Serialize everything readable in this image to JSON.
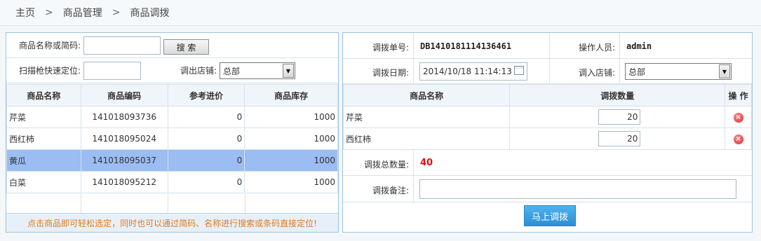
{
  "breadcrumb": {
    "home": "主页",
    "sep1": ">",
    "level1": "商品管理",
    "sep2": ">",
    "level2": "商品调拨"
  },
  "search": {
    "name_label": "商品名称或简码:",
    "name_value": "",
    "search_button": "搜 索",
    "scan_label": "扫描枪快速定位:",
    "scan_value": "",
    "out_store_label": "调出店铺:",
    "out_store_value": "总部"
  },
  "products": {
    "headers": [
      "商品名称",
      "商品编码",
      "参考进价",
      "商品库存"
    ],
    "rows": [
      {
        "name": "芹菜",
        "code": "141018093736",
        "price": "0",
        "stock": "1000"
      },
      {
        "name": "西红柿",
        "code": "141018095024",
        "price": "0",
        "stock": "1000"
      },
      {
        "name": "黄瓜",
        "code": "141018095037",
        "price": "0",
        "stock": "1000"
      },
      {
        "name": "白菜",
        "code": "141018095212",
        "price": "0",
        "stock": "1000"
      }
    ],
    "selected_index": 2,
    "tip": "点击商品即可轻松选定，同时也可以通过简码、名称进行搜索或条码直接定位!"
  },
  "transfer": {
    "order_label": "调拨单号:",
    "order_no": "DB1410181114136461",
    "operator_label": "操作人员:",
    "operator": "admin",
    "date_label": "调拨日期:",
    "date_value": "2014/10/18 11:14:13",
    "in_store_label": "调入店铺:",
    "in_store_value": "总部",
    "headers": [
      "商品名称",
      "调拨数量",
      "操 作"
    ],
    "items": [
      {
        "name": "芹菜",
        "qty": "20"
      },
      {
        "name": "西红柿",
        "qty": "20"
      }
    ],
    "total_label": "调拨总数量:",
    "total": "40",
    "remark_label": "调拨备注:",
    "remark_value": "",
    "submit": "马上调拨"
  },
  "icons": {
    "delete": "delete-circle-icon",
    "calendar": "calendar-icon",
    "dropdown": "dropdown-arrow-icon"
  },
  "colors": {
    "selected_row": "#9bbdf4",
    "tip_text": "#e07a1d",
    "total": "#e01010",
    "submit_button": "#2b8fd3"
  }
}
